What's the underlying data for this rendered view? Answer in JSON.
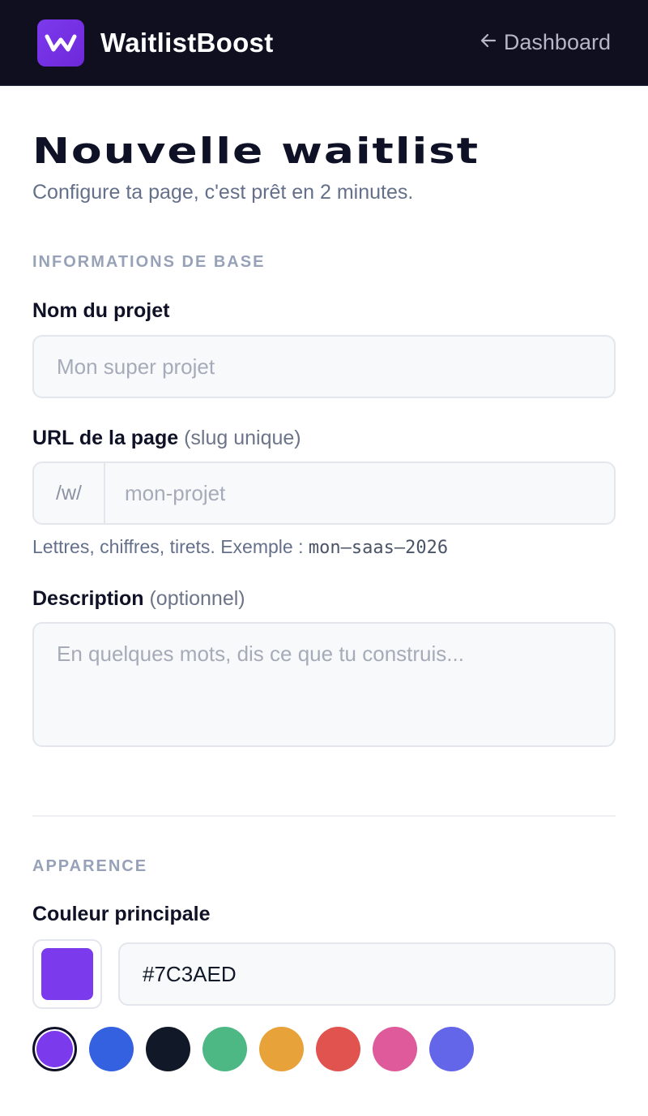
{
  "header": {
    "brand_name": "WaitlistBoost",
    "back_link": "Dashboard"
  },
  "page": {
    "title": "Nouvelle waitlist",
    "subtitle": "Configure ta page, c'est prêt en 2 minutes."
  },
  "sections": {
    "basic": {
      "heading": "INFORMATIONS DE BASE",
      "project_name": {
        "label": "Nom du projet",
        "placeholder": "Mon super projet"
      },
      "slug": {
        "label": "URL de la page",
        "label_note": "(slug unique)",
        "prefix": "/w/",
        "placeholder": "mon-projet",
        "hint_text": "Lettres, chiffres, tirets. Exemple :",
        "hint_example": "mon–saas–2026"
      },
      "description": {
        "label": "Description",
        "label_note": "(optionnel)",
        "placeholder": "En quelques mots, dis ce que tu construis..."
      }
    },
    "appearance": {
      "heading": "APPARENCE",
      "primary_color": {
        "label": "Couleur principale",
        "value": "#7C3AED"
      },
      "presets": [
        {
          "color": "#7c3aed",
          "selected": true
        },
        {
          "color": "#3461e0",
          "selected": false
        },
        {
          "color": "#111827",
          "selected": false
        },
        {
          "color": "#4db883",
          "selected": false
        },
        {
          "color": "#e8a23a",
          "selected": false
        },
        {
          "color": "#e0534f",
          "selected": false
        },
        {
          "color": "#de5a9a",
          "selected": false
        },
        {
          "color": "#6366e8",
          "selected": false
        }
      ]
    }
  }
}
